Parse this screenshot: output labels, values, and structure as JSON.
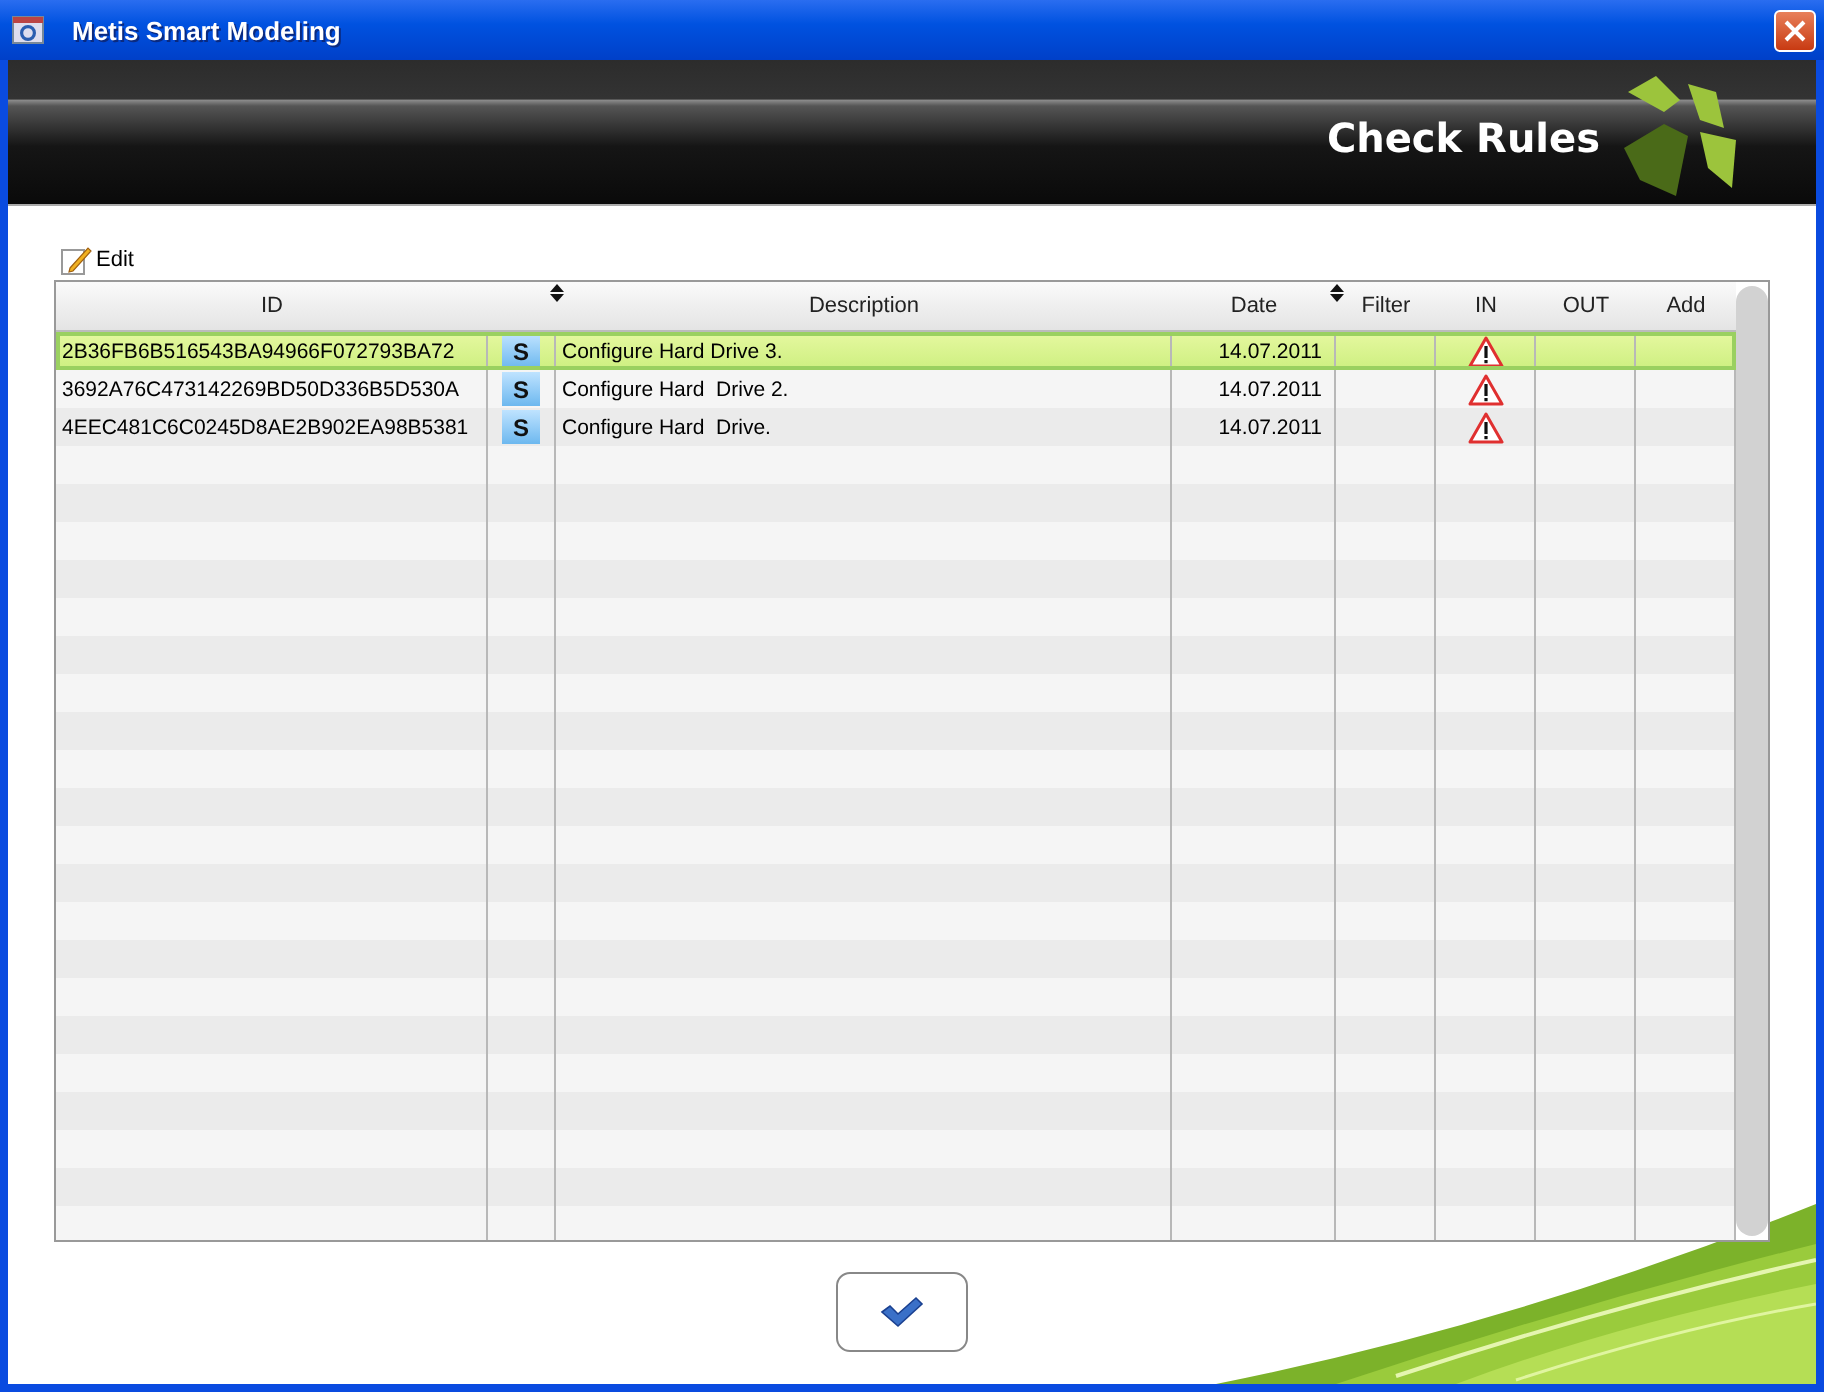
{
  "window": {
    "title": "Metis Smart Modeling"
  },
  "header": {
    "title": "Check Rules"
  },
  "toolbar": {
    "edit_label": "Edit"
  },
  "table": {
    "columns": [
      "ID",
      "",
      "Description",
      "Date",
      "Filter",
      "IN",
      "OUT",
      "Add"
    ],
    "rows": [
      {
        "id": "2B36FB6B516543BA94966F072793BA72",
        "s": "S",
        "description": "Configure Hard Drive 3.",
        "date": "14.07.2011",
        "in_warning": true,
        "selected": true
      },
      {
        "id": "3692A76C473142269BD50D336B5D530A",
        "s": "S",
        "description": "Configure Hard  Drive 2.",
        "date": "14.07.2011",
        "in_warning": true,
        "selected": false
      },
      {
        "id": "4EEC481C6C0245D8AE2B902EA98B5381",
        "s": "S",
        "description": "Configure Hard  Drive.",
        "date": "14.07.2011",
        "in_warning": true,
        "selected": false
      }
    ]
  }
}
